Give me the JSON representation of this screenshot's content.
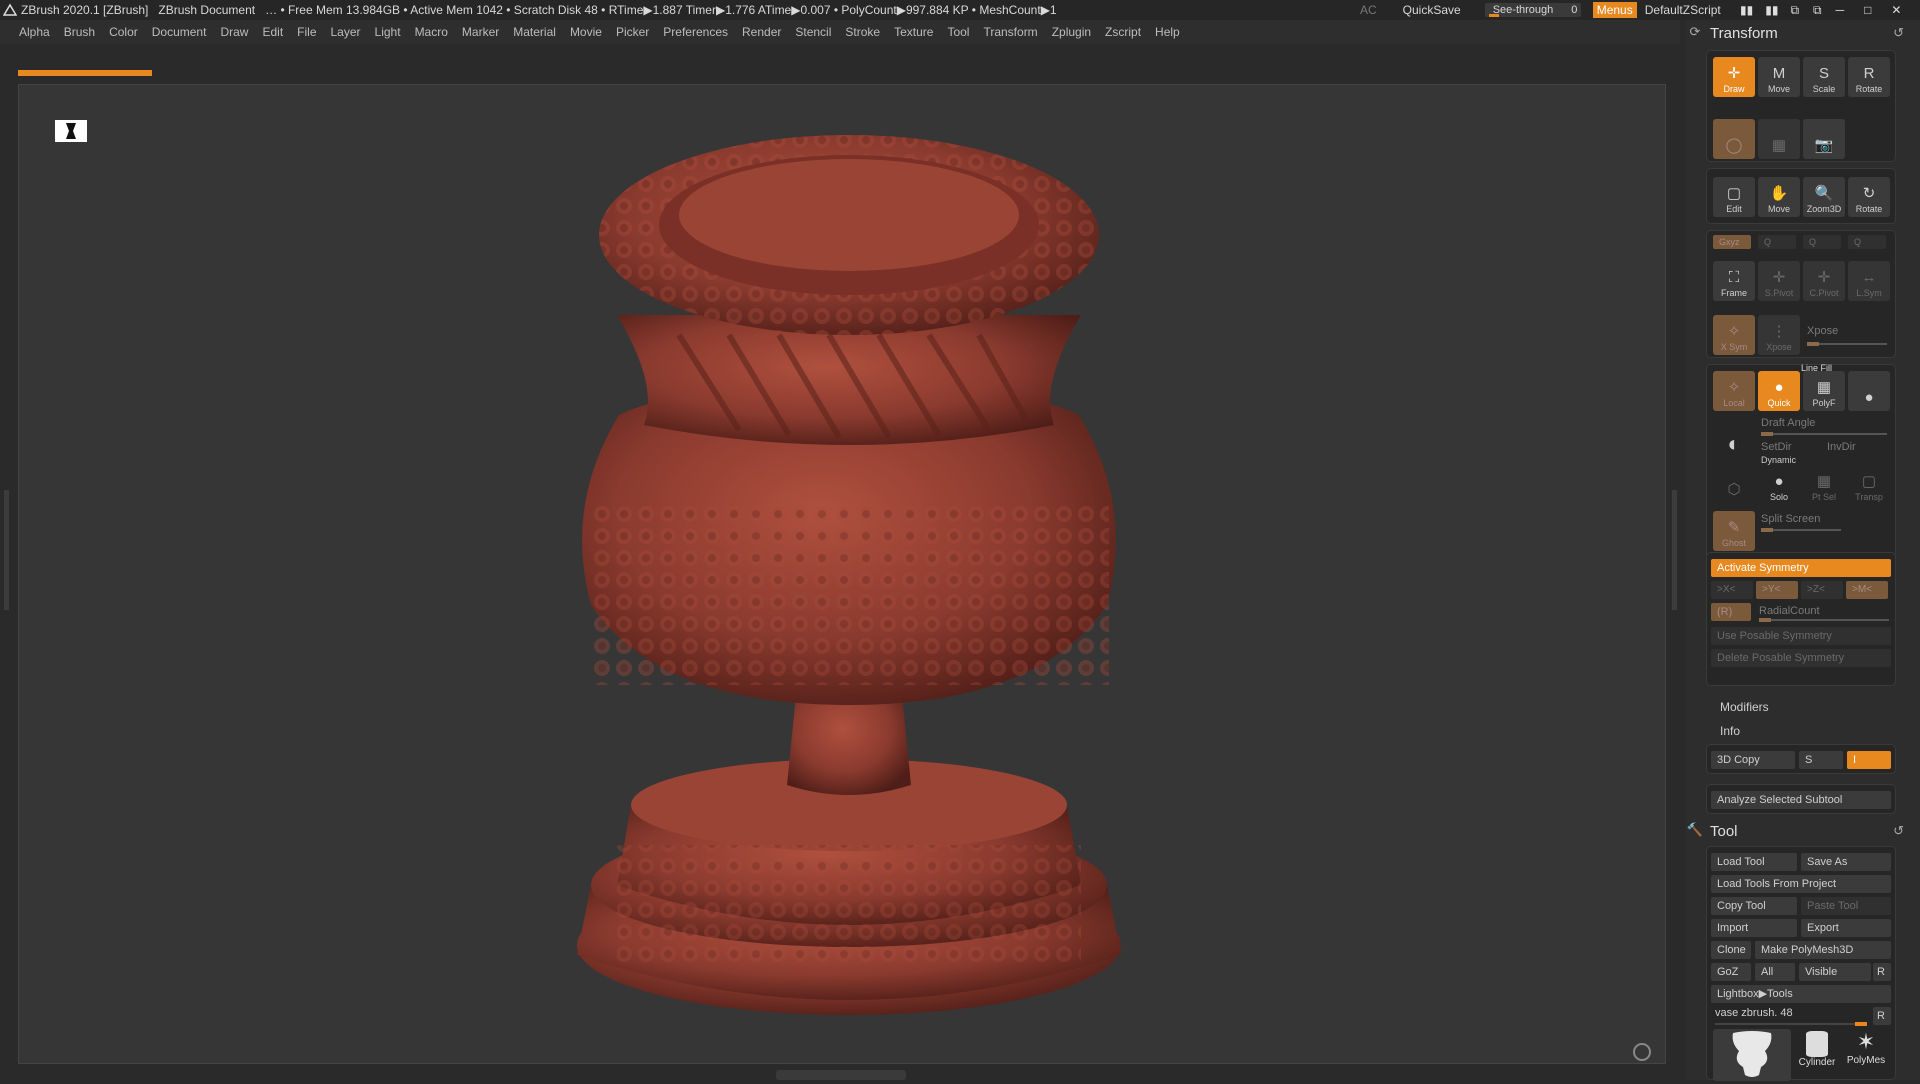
{
  "titlebar": {
    "app": "ZBrush 2020.1 [ZBrush]",
    "document": "ZBrush Document",
    "stats": "… • Free Mem 13.984GB • Active Mem 1042 • Scratch Disk 48 •  RTime▶1.887 Timer▶1.776 ATime▶0.007 • PolyCount▶997.884 KP  • MeshCount▶1",
    "ac": "AC",
    "quicksave": "QuickSave",
    "seethrough_label": "See-through",
    "seethrough_value": "0",
    "menus": "Menus",
    "script": "DefaultZScript"
  },
  "menubar": [
    "Alpha",
    "Brush",
    "Color",
    "Document",
    "Draw",
    "Edit",
    "File",
    "Layer",
    "Light",
    "Macro",
    "Marker",
    "Material",
    "Movie",
    "Picker",
    "Preferences",
    "Render",
    "Stencil",
    "Stroke",
    "Texture",
    "Tool",
    "Transform",
    "Zplugin",
    "Zscript",
    "Help"
  ],
  "transform": {
    "title": "Transform",
    "row1": [
      {
        "label": "Draw",
        "icon": "✛",
        "on": true
      },
      {
        "label": "Move",
        "icon": "M"
      },
      {
        "label": "Scale",
        "icon": "S"
      },
      {
        "label": "Rotate",
        "icon": "R"
      }
    ],
    "row2": [
      "Edit",
      "Move",
      "Zoom3D",
      "Rotate"
    ],
    "row3": [
      "Frame",
      "S.Pivot",
      "C.Pivot",
      "L.Sym"
    ],
    "row4_small": [
      "Gxyz",
      "Q",
      "Q",
      "Q"
    ],
    "xpose": "Xpose",
    "local": "Local",
    "quick": "Quick",
    "polyf": "PolyF",
    "linefill": "Line Fill",
    "draft_angle": "Draft Angle",
    "setdir": "SetDir",
    "invdir": "InvDir",
    "dynamic": "Dynamic",
    "solo": "Solo",
    "ptsel": "Pt Sel",
    "transp": "Transp",
    "ghost": "Ghost",
    "split_screen": "Split Screen",
    "activate_symmetry": "Activate Symmetry",
    "axes": [
      ">X<",
      ">Y<",
      ">Z<",
      ">M<"
    ],
    "r": "(R)",
    "radialcount": "RadialCount",
    "use_posable": "Use Posable Symmetry",
    "delete_posable": "Delete Posable Symmetry",
    "modifiers": "Modifiers",
    "info": "Info",
    "copy3d": "3D Copy",
    "s": "S",
    "i": "I",
    "analyze": "Analyze Selected Subtool"
  },
  "tool": {
    "title": "Tool",
    "load_tool": "Load Tool",
    "save_as": "Save As",
    "load_from_project": "Load Tools From Project",
    "copy_tool": "Copy Tool",
    "paste_tool": "Paste Tool",
    "import": "Import",
    "export": "Export",
    "clone": "Clone",
    "make_polymesh": "Make PolyMesh3D",
    "goz": "GoZ",
    "all": "All",
    "visible": "Visible",
    "r": "R",
    "lightbox": "Lightbox▶Tools",
    "current_tool": "vase zbrush. 48",
    "thumbs": [
      "Cylinder",
      "PolyMes"
    ]
  },
  "colors": {
    "accent": "#e8891f",
    "vase": "#8a3a2e",
    "bg": "#363636"
  }
}
